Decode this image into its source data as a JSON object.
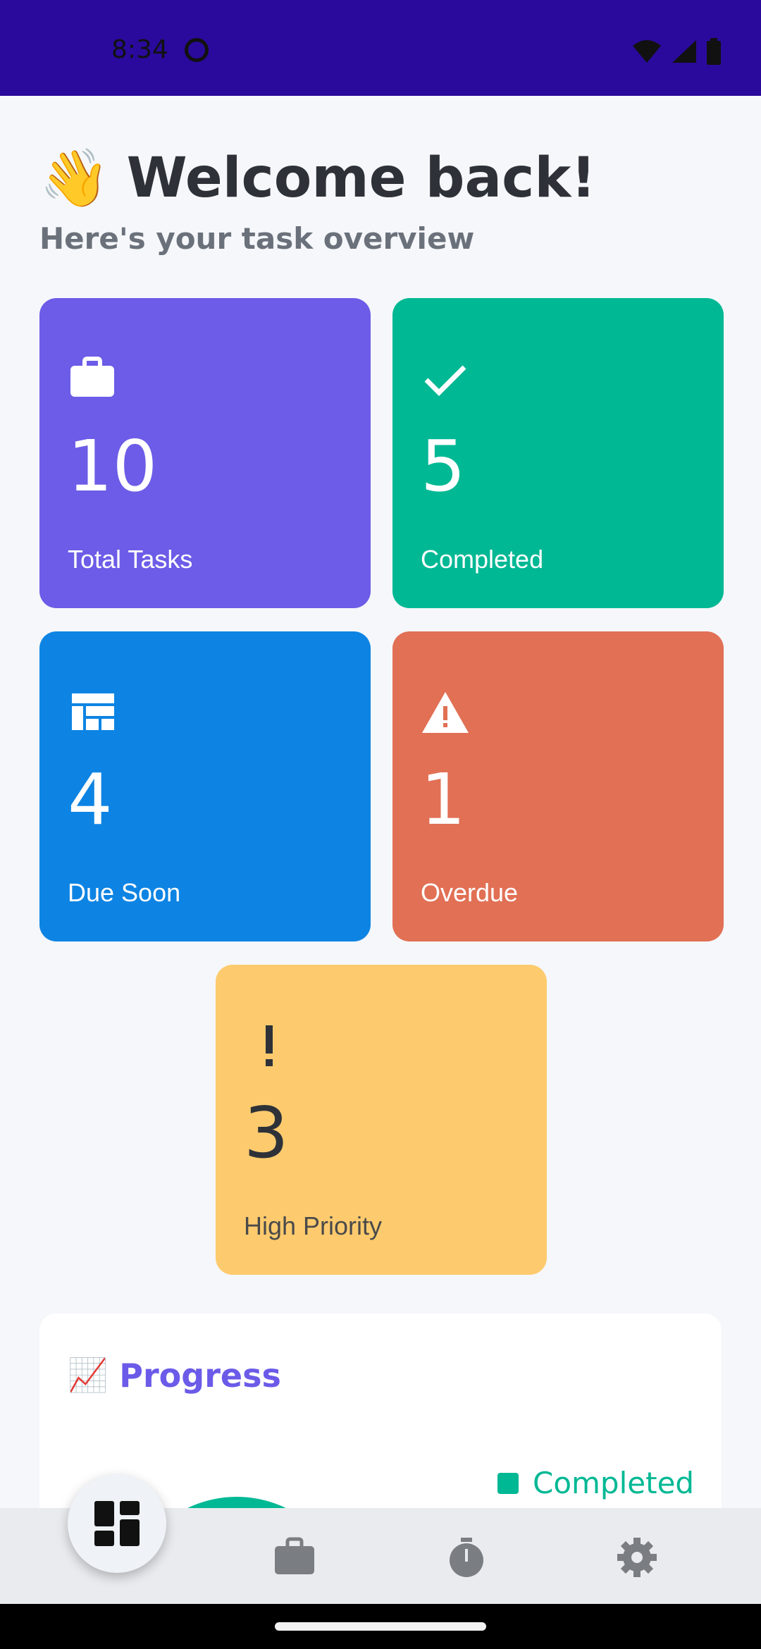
{
  "status_bar": {
    "time": "8:34"
  },
  "header": {
    "emoji": "👋",
    "title": "Welcome back!",
    "subtitle": "Here's your task overview"
  },
  "cards": {
    "total": {
      "value": "10",
      "label": "Total Tasks",
      "color": "#6C5CE7",
      "icon": "briefcase-icon"
    },
    "completed": {
      "value": "5",
      "label": "Completed",
      "color": "#00B894",
      "icon": "check-icon"
    },
    "due_soon": {
      "value": "4",
      "label": "Due Soon",
      "color": "#0D84E3",
      "icon": "dashboard-icon"
    },
    "overdue": {
      "value": "1",
      "label": "Overdue",
      "color": "#E17055",
      "icon": "warning-icon"
    },
    "high_priority": {
      "value": "3",
      "label": "High Priority",
      "color": "#FDCB6E",
      "icon": "exclamation-icon"
    }
  },
  "progress": {
    "emoji": "📈",
    "title": "Progress",
    "legend": [
      {
        "label": "Completed",
        "color": "#00B894"
      }
    ]
  },
  "nav": {
    "items": [
      {
        "icon": "dashboard-icon"
      },
      {
        "icon": "briefcase-icon"
      },
      {
        "icon": "timer-icon"
      },
      {
        "icon": "gear-icon"
      }
    ]
  }
}
